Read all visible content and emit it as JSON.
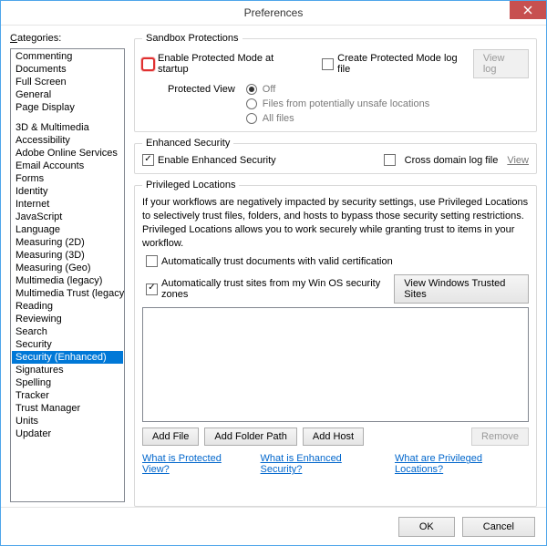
{
  "window": {
    "title": "Preferences"
  },
  "categories_label": "Categories:",
  "categories": {
    "group1": [
      "Commenting",
      "Documents",
      "Full Screen",
      "General",
      "Page Display"
    ],
    "group2": [
      "3D & Multimedia",
      "Accessibility",
      "Adobe Online Services",
      "Email Accounts",
      "Forms",
      "Identity",
      "Internet",
      "JavaScript",
      "Language",
      "Measuring (2D)",
      "Measuring (3D)",
      "Measuring (Geo)",
      "Multimedia (legacy)",
      "Multimedia Trust (legacy)",
      "Reading",
      "Reviewing",
      "Search",
      "Security",
      "Security (Enhanced)",
      "Signatures",
      "Spelling",
      "Tracker",
      "Trust Manager",
      "Units",
      "Updater"
    ],
    "selected": "Security (Enhanced)"
  },
  "sandbox": {
    "legend": "Sandbox Protections",
    "enable_protected_mode": "Enable Protected Mode at startup",
    "create_log": "Create Protected Mode log file",
    "view_log": "View log",
    "protected_view_label": "Protected View",
    "pv_off": "Off",
    "pv_unsafe": "Files from potentially unsafe locations",
    "pv_all": "All files"
  },
  "enhanced": {
    "legend": "Enhanced Security",
    "enable": "Enable Enhanced Security",
    "cross_log": "Cross domain log file",
    "view": "View"
  },
  "priv": {
    "legend": "Privileged Locations",
    "desc": "If your workflows are negatively impacted by security settings, use Privileged Locations to selectively trust files, folders, and hosts to bypass those security setting restrictions. Privileged Locations allows you to work securely while granting trust to items in your workflow.",
    "auto_valid": "Automatically trust documents with valid certification",
    "auto_zones": "Automatically trust sites from my Win OS security zones",
    "view_trusted": "View Windows Trusted Sites",
    "add_file": "Add File",
    "add_folder": "Add Folder Path",
    "add_host": "Add Host",
    "remove": "Remove"
  },
  "links": {
    "l1": "What is Protected View?",
    "l2": "What is Enhanced Security?",
    "l3": "What are Privileged Locations?"
  },
  "buttons": {
    "ok": "OK",
    "cancel": "Cancel"
  }
}
